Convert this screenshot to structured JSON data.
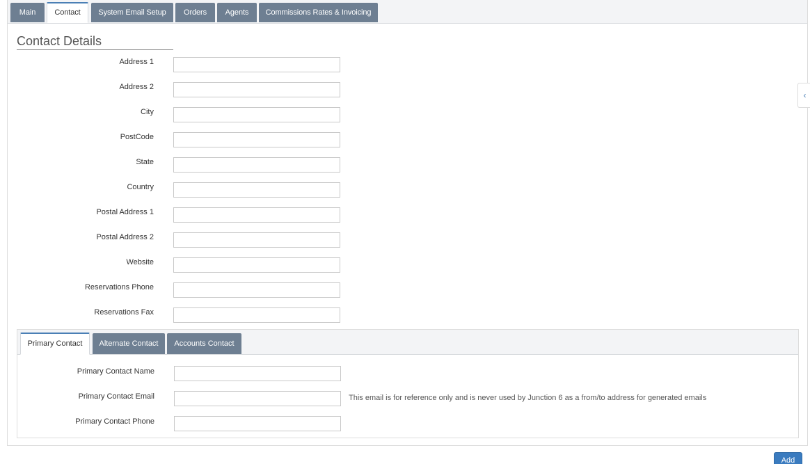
{
  "tabs": [
    {
      "label": "Main",
      "active": false
    },
    {
      "label": "Contact",
      "active": true
    },
    {
      "label": "System Email Setup",
      "active": false
    },
    {
      "label": "Orders",
      "active": false
    },
    {
      "label": "Agents",
      "active": false
    },
    {
      "label": "Commissions Rates & Invoicing",
      "active": false
    }
  ],
  "section_title": "Contact Details",
  "fields": [
    {
      "label": "Address 1",
      "value": ""
    },
    {
      "label": "Address 2",
      "value": ""
    },
    {
      "label": "City",
      "value": ""
    },
    {
      "label": "PostCode",
      "value": ""
    },
    {
      "label": "State",
      "value": ""
    },
    {
      "label": "Country",
      "value": ""
    },
    {
      "label": "Postal Address 1",
      "value": ""
    },
    {
      "label": "Postal Address 2",
      "value": ""
    },
    {
      "label": "Website",
      "value": ""
    },
    {
      "label": "Reservations Phone",
      "value": ""
    },
    {
      "label": "Reservations Fax",
      "value": ""
    }
  ],
  "contact_tabs": [
    {
      "label": "Primary Contact",
      "active": true
    },
    {
      "label": "Alternate Contact",
      "active": false
    },
    {
      "label": "Accounts Contact",
      "active": false
    }
  ],
  "contact_fields": [
    {
      "label": "Primary Contact Name",
      "value": ""
    },
    {
      "label": "Primary Contact Email",
      "value": ""
    },
    {
      "label": "Primary Contact Phone",
      "value": ""
    }
  ],
  "email_hint": "This email is for reference only and is never used by Junction 6 as a from/to address for generated emails",
  "side_toggle_icon": "chevron-left-icon",
  "add_button_label": "Add"
}
